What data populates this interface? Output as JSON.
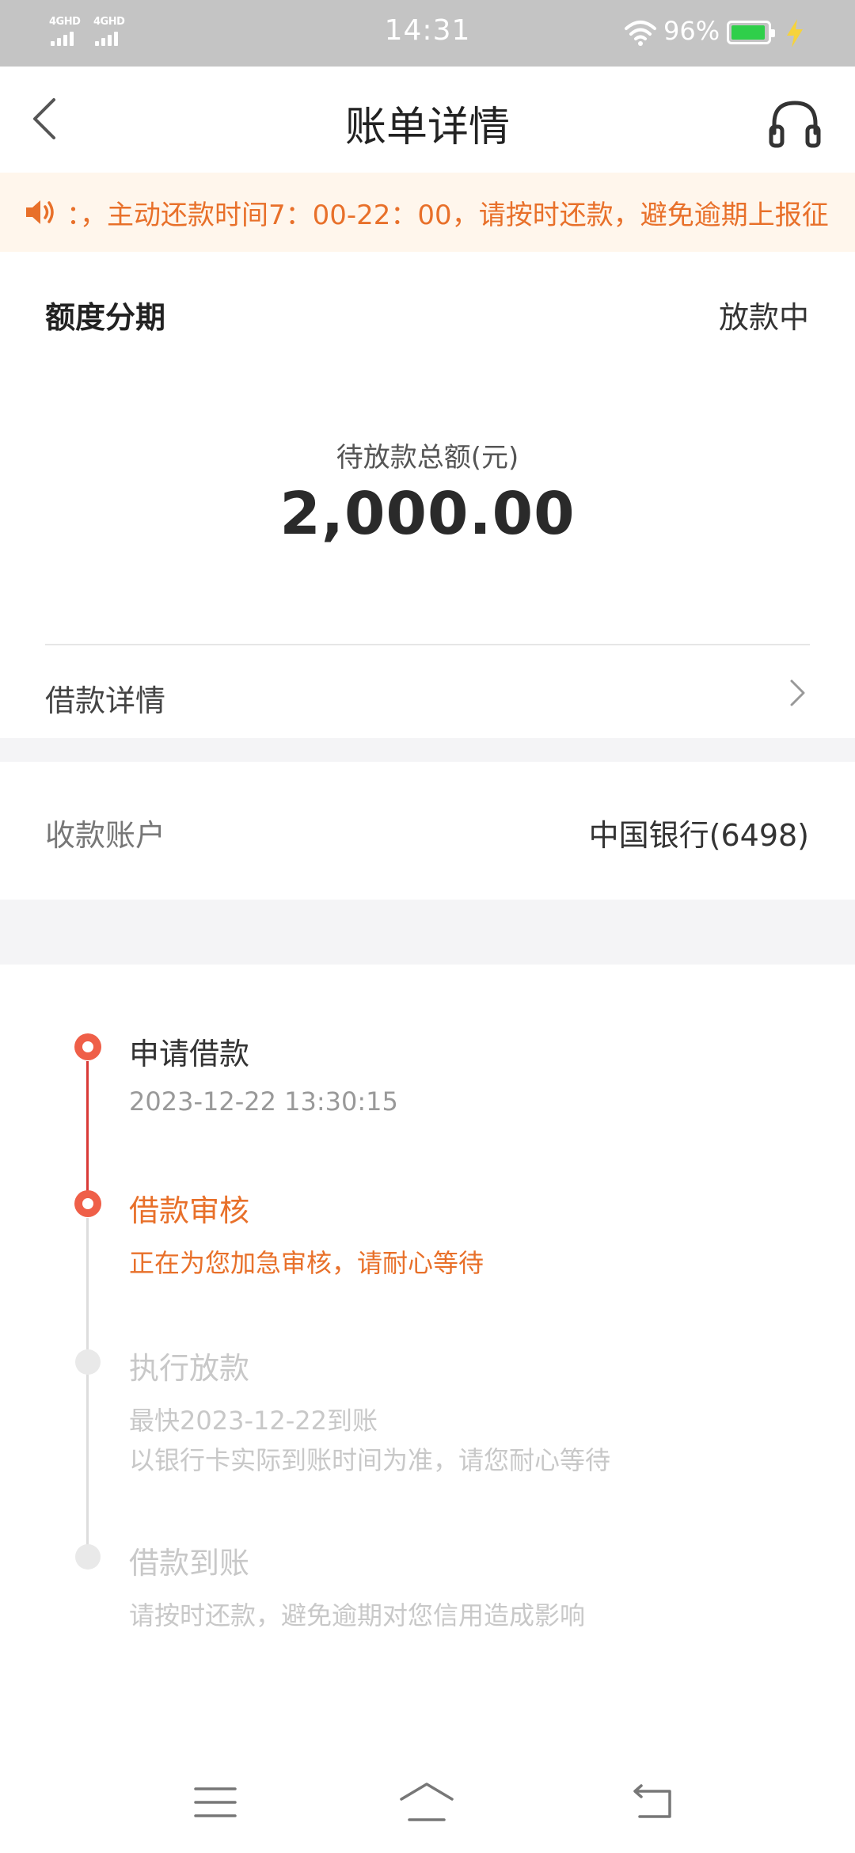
{
  "status_bar": {
    "signal1_label": "4GHD",
    "signal2_label": "4GHD",
    "time": "14:31",
    "battery_percent": "96%",
    "battery_level": 0.96,
    "icons": [
      "signal-icon",
      "wifi-icon",
      "battery-icon",
      "charging-icon"
    ]
  },
  "header": {
    "title": "账单详情",
    "back_icon": "chevron-left-icon",
    "support_icon": "headset-icon"
  },
  "notice": {
    "icon": "speaker-icon",
    "text": "：，主动还款时间7：00-22：00，请按时还款，避免逾期上报征"
  },
  "summary": {
    "product_name": "额度分期",
    "status": "放款中",
    "amount_label": "待放款总额(元)",
    "amount": "2,000.00"
  },
  "loan_detail": {
    "label": "借款详情"
  },
  "account": {
    "label": "收款账户",
    "value": "中国银行(6498)"
  },
  "timeline": [
    {
      "title": "申请借款",
      "lines": [
        "2023-12-22 13:30:15"
      ],
      "state": "done"
    },
    {
      "title": "借款审核",
      "lines": [
        "正在为您加急审核，请耐心等待"
      ],
      "state": "active"
    },
    {
      "title": "执行放款",
      "lines": [
        "最快2023-12-22到账",
        "以银行卡实际到账时间为准，请您耐心等待"
      ],
      "state": "pending"
    },
    {
      "title": "借款到账",
      "lines": [
        "请按时还款，避免逾期对您信用造成影响"
      ],
      "state": "pending"
    }
  ],
  "colors": {
    "accent": "#e8702a",
    "timeline_red": "#ef5f48",
    "notice_bg": "#fff6ec",
    "status_bar_bg": "#c4c4c4",
    "battery_green": "#2fcf4a"
  },
  "system_nav": {
    "icons": [
      "menu-icon",
      "home-icon",
      "back-icon"
    ]
  }
}
